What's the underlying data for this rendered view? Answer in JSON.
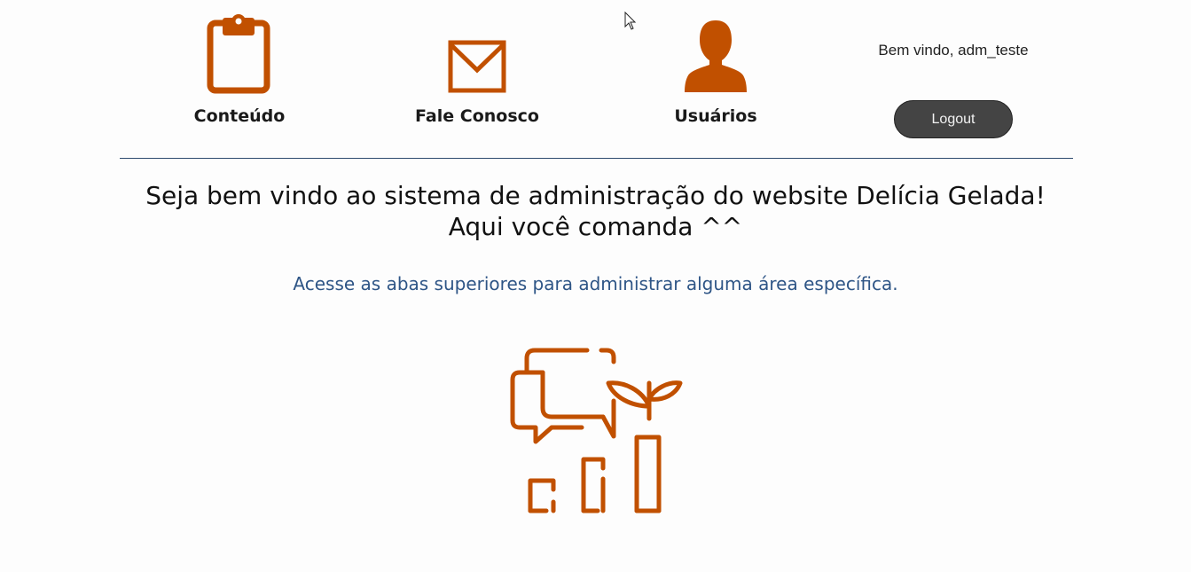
{
  "nav": {
    "items": [
      {
        "label": "Conteúdo",
        "icon": "clipboard-icon"
      },
      {
        "label": "Fale Conosco",
        "icon": "envelope-icon"
      },
      {
        "label": "Usuários",
        "icon": "user-icon"
      }
    ]
  },
  "user": {
    "welcome": "Bem vindo, adm_teste",
    "logout_label": "Logout"
  },
  "main": {
    "headline_line1": "Seja bem vindo ao sistema de administração do website Delícia Gelada!",
    "headline_line2": "Aqui você comanda ^^",
    "subline": "Acesse as abas superiores para administrar alguma área específica."
  },
  "colors": {
    "accent": "#c15000",
    "text_blue": "#2e5586",
    "button_bg": "#444444",
    "divider": "#2d4a6e"
  },
  "illustration": {
    "icon": "chat-growth-chart-icon"
  }
}
